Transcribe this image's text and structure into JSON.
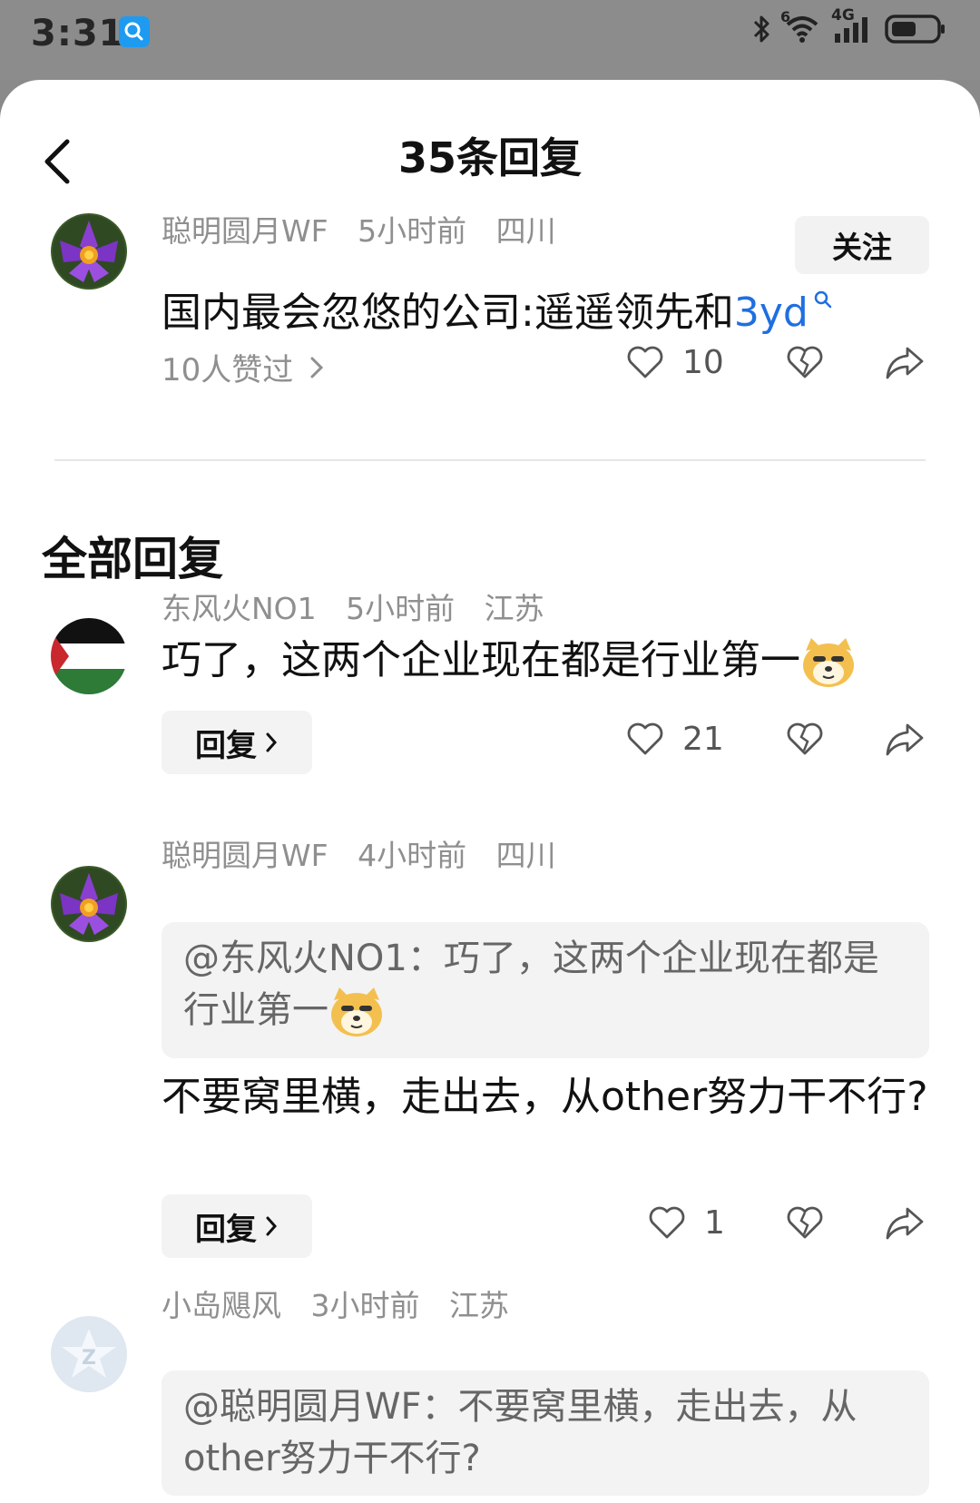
{
  "status_bar": {
    "time": "3:31",
    "bluetooth_icon": "bluetooth-icon",
    "wifi_badge": "6",
    "network": "4G",
    "battery_icon": "battery-icon",
    "app_icon": "search-app-icon"
  },
  "header": {
    "title": "35条回复",
    "back_icon": "back-chevron-icon"
  },
  "original_post": {
    "username": "聪明圆月WF",
    "time": "5小时前",
    "location": "四川",
    "follow_label": "关注",
    "text": "国内最会忽悠的公司:遥遥领先和",
    "topic_link": "3yd",
    "likers": "10人赞过",
    "like_count": "10"
  },
  "section_title": "全部回复",
  "replies": [
    {
      "username": "东风火NO1",
      "time": "5小时前",
      "location": "江苏",
      "text": "巧了，这两个企业现在都是行业第一",
      "reply_label": "回复",
      "like_count": "21"
    },
    {
      "username": "聪明圆月WF",
      "time": "4小时前",
      "location": "四川",
      "quote": "@东风火NO1：巧了，这两个企业现在都是行业第一",
      "text": "不要窝里横，走出去，从other努力干不行?",
      "reply_label": "回复",
      "like_count": "1"
    },
    {
      "username": "小岛飓风",
      "time": "3小时前",
      "location": "江苏",
      "quote": "@聪明圆月WF：不要窝里横，走出去，从other努力干不行?"
    }
  ],
  "colors": {
    "accent_link": "#1f6fe0",
    "meta_gray": "#8f8f8f",
    "button_bg": "#f3f3f3"
  }
}
